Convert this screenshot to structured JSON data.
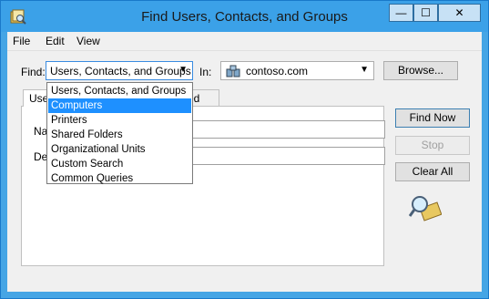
{
  "window": {
    "title": "Find Users, Contacts, and Groups",
    "min_glyph": "—",
    "max_glyph": "☐",
    "close_glyph": "✕"
  },
  "menu": {
    "items": [
      "File",
      "Edit",
      "View"
    ]
  },
  "find": {
    "label": "Find:",
    "selected": "Users, Contacts, and Groups",
    "options": [
      "Users, Contacts, and Groups",
      "Computers",
      "Printers",
      "Shared Folders",
      "Organizational Units",
      "Custom Search",
      "Common Queries"
    ],
    "highlighted_index": 1
  },
  "in": {
    "label": "In:",
    "selected": "contoso.com",
    "icon": "domain-icon"
  },
  "buttons": {
    "browse": "Browse...",
    "find_now": "Find Now",
    "stop": "Stop",
    "clear_all": "Clear All"
  },
  "tabs": {
    "users_partial": "Use",
    "advanced_partial": "ced"
  },
  "fields": {
    "name_partial": "Na",
    "description_partial": "De"
  },
  "colors": {
    "titlebar": "#3ba1e8",
    "highlight": "#1e90ff",
    "accent_border": "#3a8ce0"
  }
}
